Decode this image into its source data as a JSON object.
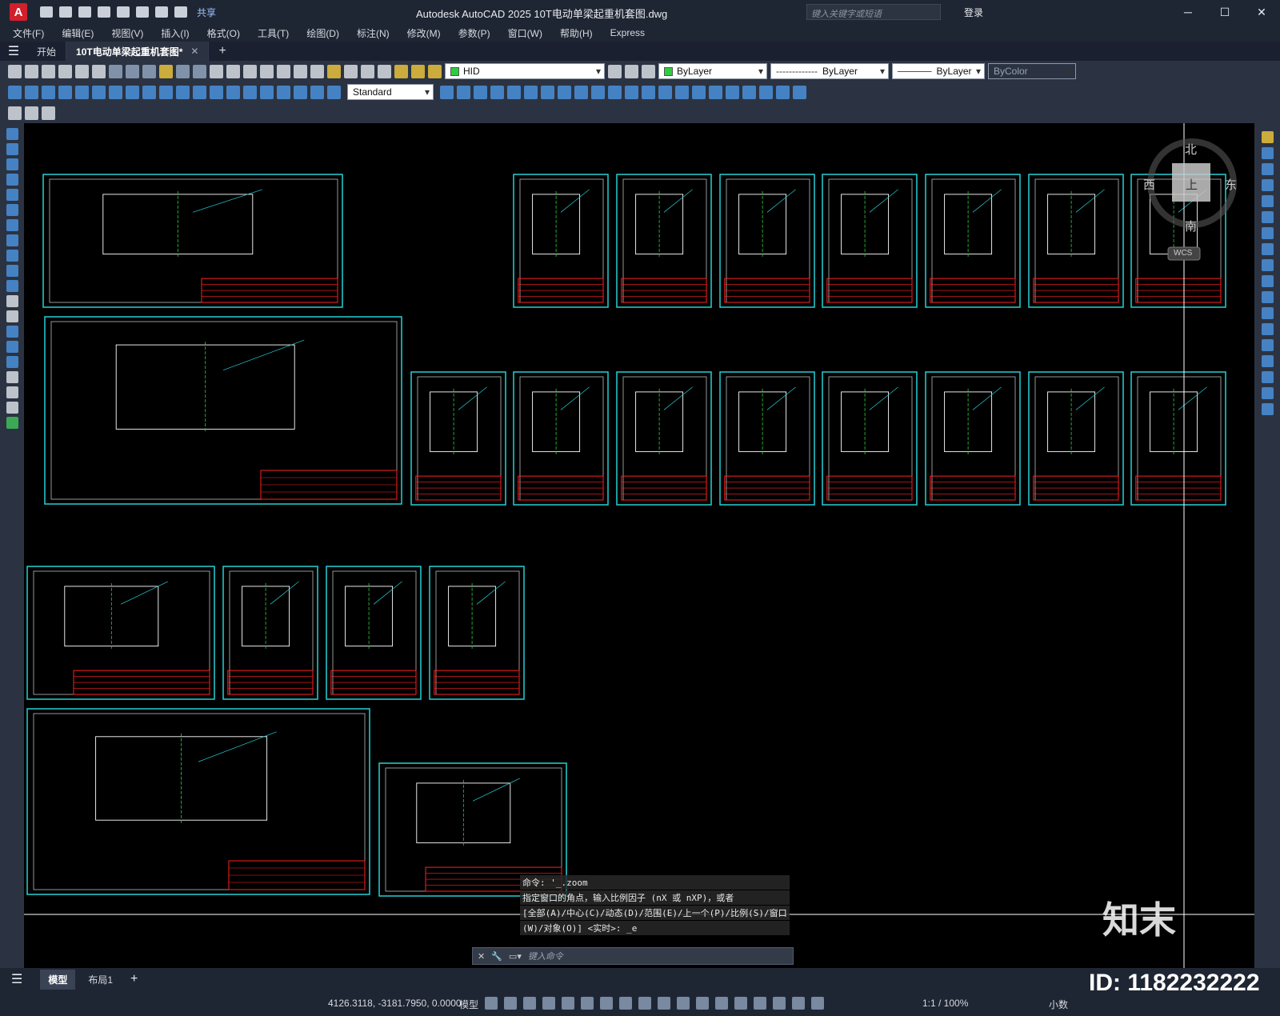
{
  "window": {
    "title": "Autodesk AutoCAD 2025     10T电动单梁起重机套图.dwg",
    "share_label": "共享",
    "search_placeholder": "键入关键字或短语",
    "login_label": "登录"
  },
  "menu": [
    "文件(F)",
    "编辑(E)",
    "视图(V)",
    "插入(I)",
    "格式(O)",
    "工具(T)",
    "绘图(D)",
    "标注(N)",
    "修改(M)",
    "参数(P)",
    "窗口(W)",
    "帮助(H)",
    "Express"
  ],
  "tabs": [
    {
      "label": "开始"
    },
    {
      "label": "10T电动单梁起重机套图*"
    }
  ],
  "properties": {
    "layer": "HID",
    "color": "ByLayer",
    "linetype": "ByLayer",
    "lineweight": "ByLayer",
    "plotstyle": "ByColor",
    "text_style": "Standard"
  },
  "viewcube": {
    "north": "北",
    "south": "南",
    "east": "东",
    "west": "西",
    "top": "上",
    "wcs": "WCS"
  },
  "command": {
    "history": [
      "命令: '_.zoom",
      "指定窗口的角点，输入比例因子 (nX 或 nXP)，或者",
      "[全部(A)/中心(C)/动态(D)/范围(E)/上一个(P)/比例(S)/窗口",
      "(W)/对象(O)] <实时>: _e"
    ],
    "placeholder": "键入命令"
  },
  "layout_tabs": [
    {
      "label": "模型"
    },
    {
      "label": "布局1"
    }
  ],
  "status": {
    "coordinates": "4126.3118, -3181.7950, 0.0000",
    "space": "模型",
    "scale": "1:1 / 100%",
    "units": "小数"
  },
  "watermark": {
    "brand": "知末",
    "id": "ID: 1182232222"
  },
  "colors": {
    "frame": "#25d0d6",
    "titleblock": "#ff2020",
    "drawing": "#ffffff",
    "centerline": "#30d040",
    "background": "#000000"
  }
}
